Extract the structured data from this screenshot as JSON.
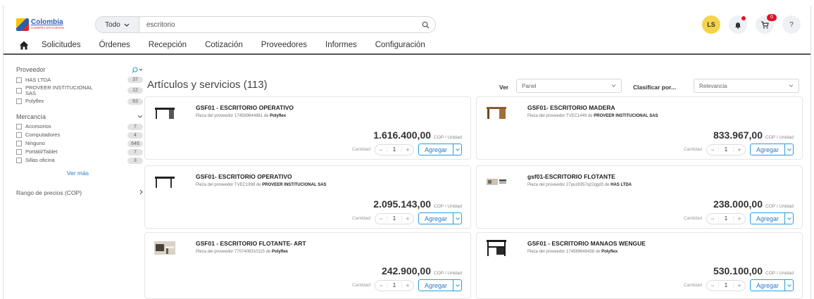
{
  "header": {
    "logo": {
      "title": "Colombia",
      "subtitle": "COMPRA EFICIENTE"
    },
    "search": {
      "scope": "Todo",
      "query": "escritorio"
    },
    "user_initials": "LS",
    "cart_badge": "0"
  },
  "nav": {
    "items": [
      "Solicitudes",
      "Órdenes",
      "Recepción",
      "Cotización",
      "Proveedores",
      "Informes",
      "Configuración"
    ]
  },
  "sidebar": {
    "proveedor_label": "Proveedor",
    "proveedores": [
      {
        "label": "HAS LTDA",
        "count": "37"
      },
      {
        "label": "PROVEER INSTITUCIONAL SAS",
        "count": "12"
      },
      {
        "label": "Polyflex",
        "count": "63"
      }
    ],
    "mercancia_label": "Mercancía",
    "mercancias": [
      {
        "label": "Accesorios",
        "count": "7"
      },
      {
        "label": "Computadores",
        "count": "4"
      },
      {
        "label": "Ninguno",
        "count": "646"
      },
      {
        "label": "Portátil/Tablet",
        "count": "7"
      },
      {
        "label": "Sillas oficina",
        "count": "3"
      }
    ],
    "ver_mas": "Ver más",
    "rango_label": "Rango de precios (COP)"
  },
  "main": {
    "title": "Artículos y servicios (113)",
    "ver_label": "Ver",
    "ver_value": "Panel",
    "sort_label": "Clasificar por...",
    "sort_value": "Relevancia",
    "qty_label": "Cantidad",
    "add_label": "Agregar",
    "unit_label": "COP / Unidad",
    "products": [
      {
        "title": "GSF01 - ESCRITORIO OPERATIVO",
        "sub_prefix": "Pieza del proveedor 174589644861 de",
        "supplier": "Polyflex",
        "price": "1.616.400,00",
        "qty": "1"
      },
      {
        "title": "GSF01- ESCRITORIO MADERA",
        "sub_prefix": "Pieza del proveedor TVEC1449 de",
        "supplier": "PROVEER INSTITUCIONAL SAS",
        "price": "833.967,00",
        "qty": "1"
      },
      {
        "title": "GSF01- ESCRITORIO OPERATIVO",
        "sub_prefix": "Pieza del proveedor TVEC1998 de",
        "supplier": "PROVEER INSTITUCIONAL SAS",
        "price": "2.095.143,00",
        "qty": "1"
      },
      {
        "title": "gsf01-ESCRITORIO FLOTANTE",
        "sub_prefix": "Pieza del proveedor 27puz8357q22qgd3 de",
        "supplier": "HAS LTDA",
        "price": "238.000,00",
        "qty": "1"
      },
      {
        "title": "GSF01 - ESCRITORIO FLOTANTE- ART",
        "sub_prefix": "Pieza del proveedor 7707408310115 de",
        "supplier": "Polyflex",
        "price": "242.900,00",
        "qty": "1"
      },
      {
        "title": "GSF01 - ESCRITORIO MANAOS WENGUE",
        "sub_prefix": "Pieza del proveedor 174589646438 de",
        "supplier": "Polyflex",
        "price": "530.100,00",
        "qty": "1"
      }
    ]
  }
}
